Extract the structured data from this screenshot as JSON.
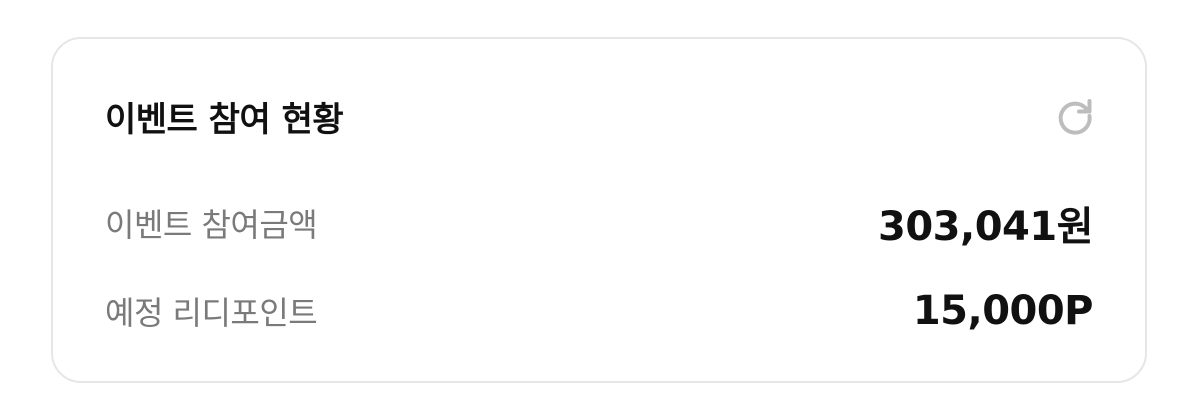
{
  "card": {
    "title": "이벤트 참여 현황",
    "refresh_icon": "refresh-icon",
    "rows": [
      {
        "label": "이벤트 참여금액",
        "value": "303,041원"
      },
      {
        "label": "예정 리디포인트",
        "value": "15,000P"
      }
    ]
  },
  "colors": {
    "title": "#111111",
    "label": "#7a7a7a",
    "value": "#111111",
    "border": "#e6e6e6",
    "icon": "#bdbdbd"
  }
}
